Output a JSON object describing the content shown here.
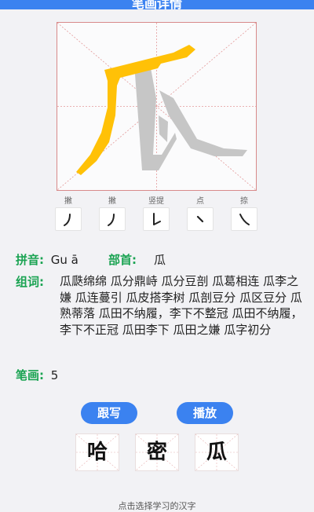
{
  "header": {
    "title": "笔画详情"
  },
  "character": {
    "glyph": "瓜"
  },
  "strokes": [
    {
      "name": "撇",
      "glyph": "丿"
    },
    {
      "name": "撇",
      "glyph": "丿"
    },
    {
      "name": "竖提",
      "glyph": "𠄌"
    },
    {
      "name": "点",
      "glyph": "丶"
    },
    {
      "name": "捺",
      "glyph": "㇏"
    }
  ],
  "info": {
    "pinyin_label": "拼音:",
    "pinyin_value": "Gu ā",
    "radical_label": "部首:",
    "radical_value": "瓜",
    "words_label": "组词:",
    "words_value": "瓜瓞绵绵 瓜分鼎峙 瓜分豆剖 瓜葛相连 瓜李之嫌 瓜连蔓引 瓜皮搭李树 瓜剖豆分 瓜区豆分 瓜熟蒂落 瓜田不纳履，李下不整冠 瓜田不纳履，李下不正冠 瓜田李下 瓜田之嫌 瓜字初分",
    "strokes_label": "笔画:",
    "strokes_value": "5"
  },
  "buttons": {
    "trace": "跟写",
    "play": "播放"
  },
  "choices": [
    "哈",
    "密",
    "瓜"
  ],
  "footer": {
    "hint": "点击选择学习的汉字"
  },
  "colors": {
    "accent": "#3b82f0",
    "label_green": "#1aa352",
    "stroke_active": "#ffc107",
    "stroke_inactive": "#c4c4c4",
    "grid_line": "#d88a8a"
  }
}
